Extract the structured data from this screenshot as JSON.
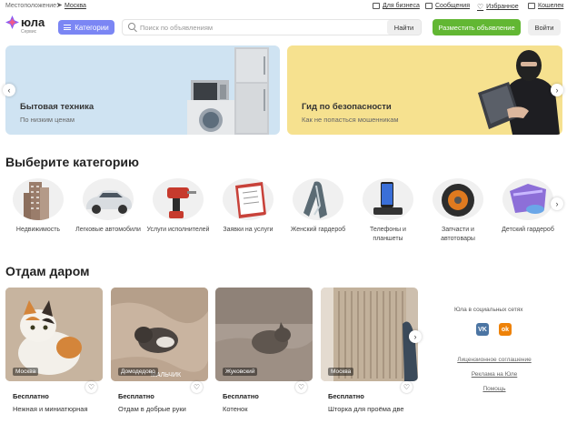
{
  "topbar": {
    "location_label": "Местоположение:",
    "location_city": "Москва",
    "links": [
      {
        "label": "Для бизнеса",
        "icon": "briefcase-icon"
      },
      {
        "label": "Сообщения",
        "icon": "message-icon"
      },
      {
        "label": "Избранное",
        "icon": "heart-icon"
      },
      {
        "label": "Кошелек",
        "icon": "wallet-icon"
      }
    ]
  },
  "header": {
    "logo_text": "юла",
    "logo_sub": "Сервис",
    "categories_button": "Категории",
    "search_placeholder": "Поиск по объявлениям",
    "search_button": "Найти",
    "post_button": "Разместить объявление",
    "login_button": "Войти"
  },
  "banners": [
    {
      "title": "Бытовая техника",
      "subtitle": "По низким ценам"
    },
    {
      "title": "Гид по безопасности",
      "subtitle": "Как не попасться мошенникам"
    }
  ],
  "categories": {
    "heading": "Выберите категорию",
    "items": [
      {
        "label": "Недвижимость"
      },
      {
        "label": "Легковые автомобили"
      },
      {
        "label": "Услуги исполнителей"
      },
      {
        "label": "Заявки на услуги"
      },
      {
        "label": "Женский гардероб"
      },
      {
        "label": "Телефоны и планшеты"
      },
      {
        "label": "Запчасти и автотовары"
      },
      {
        "label": "Детский гардероб"
      }
    ]
  },
  "giveaway": {
    "heading": "Отдам даром",
    "cards": [
      {
        "city": "Москва",
        "price": "Бесплатно",
        "title": "Нежная и миниатюрная"
      },
      {
        "city": "Домодедово",
        "price": "Бесплатно",
        "title": "Отдам в добрые руки"
      },
      {
        "city": "Жуковский",
        "price": "Бесплатно",
        "title": "Котенок"
      },
      {
        "city": "Москва",
        "price": "Бесплатно",
        "title": "Шторка для проёма две"
      }
    ],
    "photo_overlay_text": "МАЛЬЧИК"
  },
  "sidebar": {
    "social_title": "Юла в социальных сетях",
    "social": [
      {
        "label": "VK",
        "color": "#4c75a3"
      },
      {
        "label": "ok",
        "color": "#ee8208"
      }
    ],
    "links": [
      "Лицензионное соглашение",
      "Реклама на Юле",
      "Помощь"
    ]
  },
  "colors": {
    "accent": "#7b86f4",
    "post_button": "#62b733"
  }
}
